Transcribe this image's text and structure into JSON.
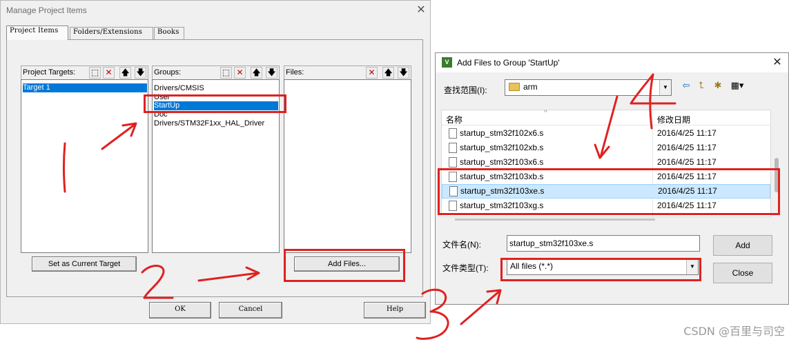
{
  "manage_dialog": {
    "title": "Manage Project Items",
    "close_glyph": "✕",
    "tabs": [
      {
        "label": "Project Items"
      },
      {
        "label": "Folders/Extensions"
      },
      {
        "label": "Books"
      }
    ],
    "targets": {
      "label": "Project Targets:",
      "items": [
        "Target 1"
      ]
    },
    "groups": {
      "label": "Groups:",
      "items": [
        "Drivers/CMSIS",
        "User",
        "StartUp",
        "Doc",
        "Drivers/STM32F1xx_HAL_Driver"
      ],
      "selected": "StartUp"
    },
    "files": {
      "label": "Files:",
      "items": []
    },
    "set_current_target_label": "Set as Current Target",
    "add_files_label": "Add Files...",
    "ok_label": "OK",
    "cancel_label": "Cancel",
    "help_label": "Help",
    "toolbar_glyphs": {
      "new": "⬚",
      "delete": "✕",
      "up": "🡅",
      "down": "🡇"
    }
  },
  "add_files_dialog": {
    "title": "Add Files to Group 'StartUp'",
    "close_glyph": "✕",
    "look_in_label": "查找范围(I):",
    "look_in_value": "arm",
    "columns": {
      "name": "名称",
      "date": "修改日期"
    },
    "files": [
      {
        "name": "startup_stm32f102x6.s",
        "date": "2016/4/25 11:17"
      },
      {
        "name": "startup_stm32f102xb.s",
        "date": "2016/4/25 11:17"
      },
      {
        "name": "startup_stm32f103x6.s",
        "date": "2016/4/25 11:17"
      },
      {
        "name": "startup_stm32f103xb.s",
        "date": "2016/4/25 11:17"
      },
      {
        "name": "startup_stm32f103xe.s",
        "date": "2016/4/25 11:17"
      },
      {
        "name": "startup_stm32f103xg.s",
        "date": "2016/4/25 11:17"
      }
    ],
    "selected_file": "startup_stm32f103xe.s",
    "filename_label": "文件名(N):",
    "filename_value": "startup_stm32f103xe.s",
    "filetype_label": "文件类型(T):",
    "filetype_value": "All files (*.*)",
    "add_label": "Add",
    "close_label": "Close",
    "app_icon_text": "V"
  },
  "annotation_color": "#e02020",
  "watermark": "CSDN @百里与司空"
}
